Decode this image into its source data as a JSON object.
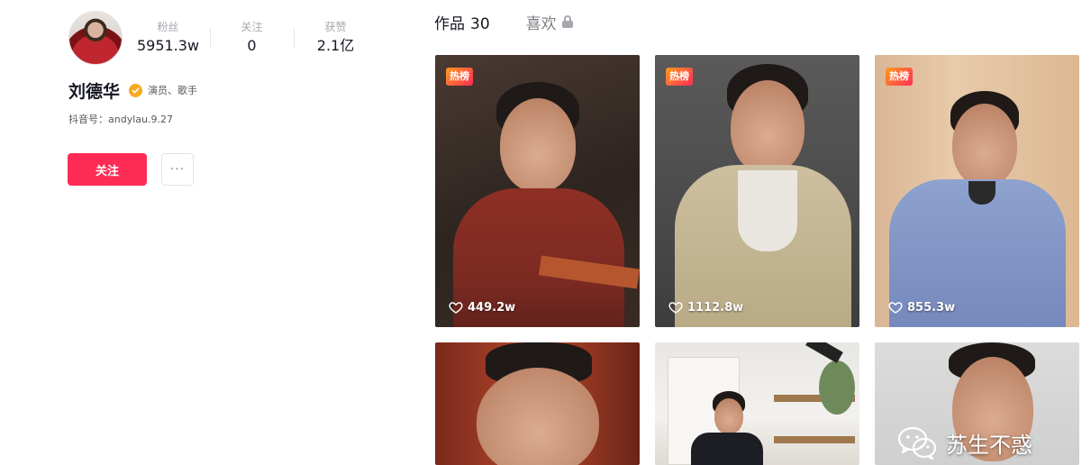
{
  "profile": {
    "name": "刘德华",
    "verified_label": "演员、歌手",
    "douyin_id": "抖音号：andylau.9.27",
    "stats": [
      {
        "label": "粉丝",
        "value": "5951.3w"
      },
      {
        "label": "关注",
        "value": "0"
      },
      {
        "label": "获赞",
        "value": "2.1亿"
      }
    ],
    "follow_label": "关注",
    "more_label": "···"
  },
  "tabs": {
    "works_label": "作品",
    "works_count": "30",
    "likes_label": "喜欢"
  },
  "videos": [
    {
      "badge": "热榜",
      "likes": "449.2w",
      "scene": "red sweater"
    },
    {
      "badge": "热榜",
      "likes": "1112.8w",
      "scene": "beige cardigan"
    },
    {
      "badge": "热榜",
      "likes": "855.3w",
      "scene": "denim jacket"
    },
    {
      "badge": "",
      "likes": "",
      "scene": "close-up face"
    },
    {
      "badge": "",
      "likes": "",
      "scene": "kitchen"
    },
    {
      "badge": "",
      "likes": "",
      "scene": "grey background"
    }
  ],
  "watermark": {
    "text": "苏生不惑",
    "icon": "wechat-icon"
  },
  "colors": {
    "accent": "#fe2c55",
    "verify": "#f7a924",
    "badge_from": "#ff9a1f"
  }
}
